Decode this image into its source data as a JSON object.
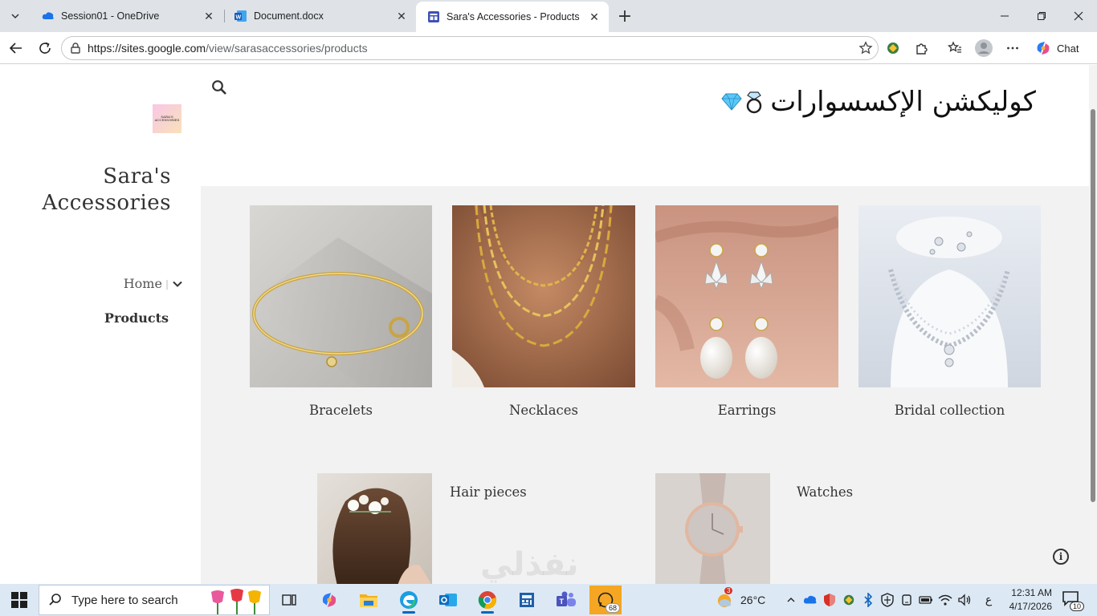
{
  "browser": {
    "tabs": [
      {
        "title": "Session01 - OneDrive",
        "icon": "onedrive-icon"
      },
      {
        "title": "Document.docx",
        "icon": "word-icon"
      },
      {
        "title": "Sara's Accessories - Products",
        "icon": "google-sites-icon"
      }
    ],
    "url_host": "https://sites.google.com",
    "url_path": "/view/sarasaccessories/products",
    "chat_label": "Chat"
  },
  "site": {
    "logo_text": "SARA'S ACCESSORIES",
    "title_line1": "Sara's",
    "title_line2": "Accessories",
    "nav": {
      "home": "Home",
      "products": "Products"
    },
    "heading": "كوليكشن الإكسسوارات",
    "heading_emoji": "💎💍"
  },
  "products": [
    {
      "label": "Bracelets"
    },
    {
      "label": "Necklaces"
    },
    {
      "label": "Earrings"
    },
    {
      "label": "Bridal collection"
    },
    {
      "label": "Hair pieces"
    },
    {
      "label": "Watches"
    }
  ],
  "watermark": "نفذلي",
  "taskbar": {
    "search_placeholder": "Type here to search",
    "weather_temp": "26°C",
    "weather_badge": "3",
    "ime": "ع",
    "time": "12:31 AM",
    "date": "4/17/2026",
    "app_badge": "68",
    "notification_count": "10"
  },
  "colors": {
    "gallery_bg": "#f2f2f2",
    "taskbar_bg": "#dce9f5",
    "tabstrip_bg": "#dfe3e8"
  }
}
